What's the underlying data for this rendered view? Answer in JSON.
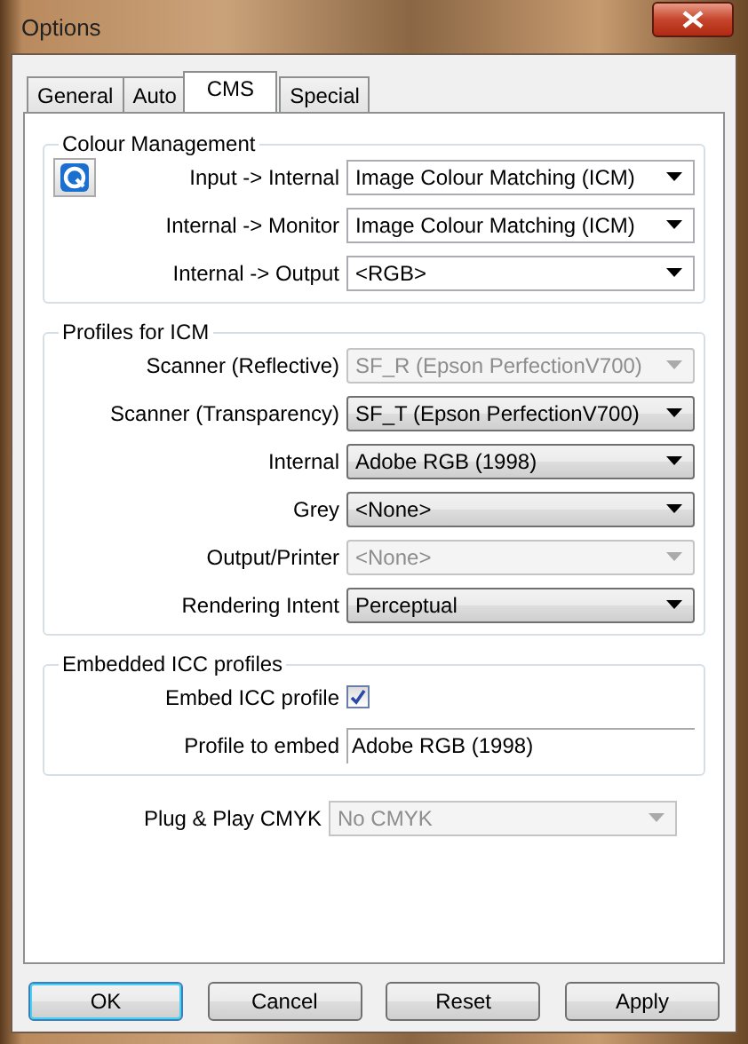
{
  "window": {
    "title": "Options"
  },
  "tabs": [
    {
      "label": "General",
      "selected": false
    },
    {
      "label": "Auto",
      "selected": false
    },
    {
      "label": "CMS",
      "selected": true
    },
    {
      "label": "Special",
      "selected": false
    }
  ],
  "sections": [
    {
      "title": "Colour Management",
      "has_icon_button": true,
      "rows": [
        {
          "kind": "combo",
          "label": "Input -> Internal",
          "value": "Image Colour Matching (ICM)",
          "disabled": false
        },
        {
          "kind": "combo",
          "label": "Internal -> Monitor",
          "value": "Image Colour Matching (ICM)",
          "disabled": false
        },
        {
          "kind": "combo",
          "label": "Internal -> Output",
          "value": "<RGB>",
          "disabled": false
        }
      ]
    },
    {
      "title": "Profiles for ICM",
      "has_icon_button": false,
      "rows": [
        {
          "kind": "list",
          "label": "Scanner (Reflective)",
          "value": "SF_R (Epson PerfectionV700)",
          "disabled": true
        },
        {
          "kind": "list",
          "label": "Scanner (Transparency)",
          "value": "SF_T (Epson PerfectionV700)",
          "disabled": false
        },
        {
          "kind": "list",
          "label": "Internal",
          "value": "Adobe RGB (1998)",
          "disabled": false
        },
        {
          "kind": "list",
          "label": "Grey",
          "value": "<None>",
          "disabled": false
        },
        {
          "kind": "list",
          "label": "Output/Printer",
          "value": "<None>",
          "disabled": true
        },
        {
          "kind": "list",
          "label": "Rendering Intent",
          "value": "Perceptual",
          "disabled": false
        }
      ]
    },
    {
      "title": "Embedded ICC profiles",
      "has_icon_button": false,
      "rows": [
        {
          "kind": "checkbox",
          "label": "Embed ICC profile",
          "checked": true
        },
        {
          "kind": "text",
          "label": "Profile to embed",
          "value": "Adobe RGB (1998)"
        }
      ]
    }
  ],
  "plug_and_play": {
    "label": "Plug & Play CMYK",
    "value": "No CMYK",
    "disabled": true
  },
  "buttons": [
    {
      "label": "OK",
      "default": true
    },
    {
      "label": "Cancel",
      "default": false
    },
    {
      "label": "Reset",
      "default": false
    },
    {
      "label": "Apply",
      "default": false
    }
  ]
}
